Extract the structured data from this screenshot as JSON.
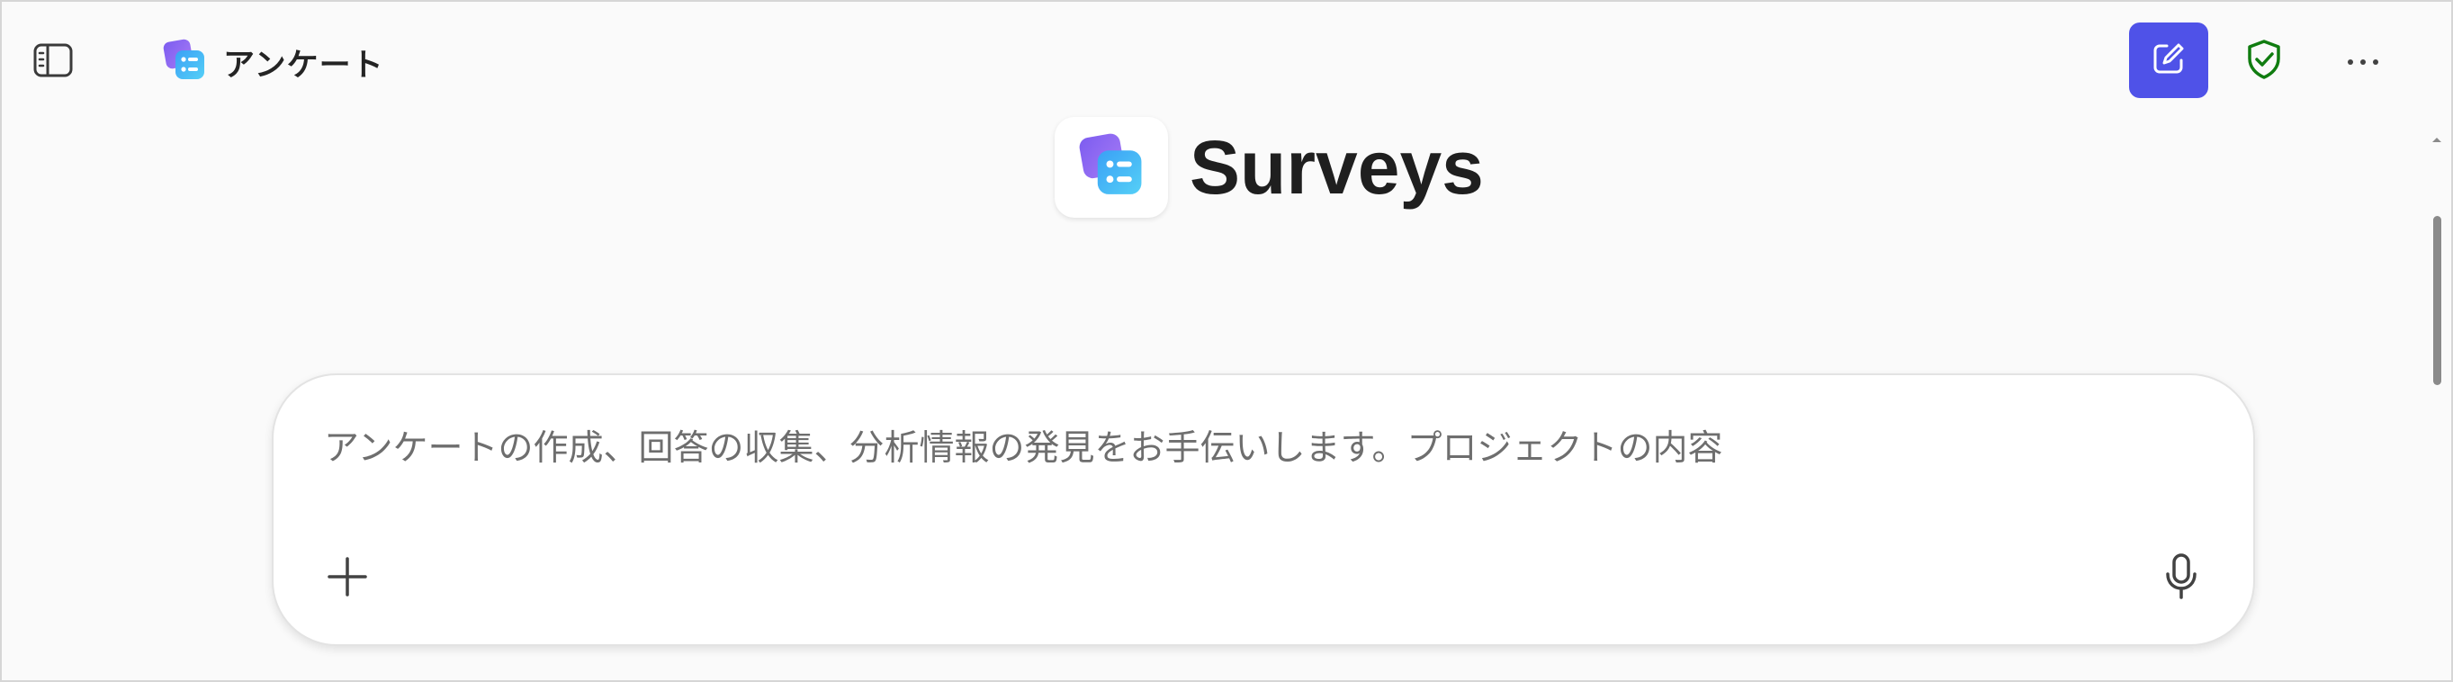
{
  "header": {
    "app_title": "アンケート",
    "icons": {
      "sidebar": "sidebar-toggle-icon",
      "app": "surveys-app-icon",
      "new_chat": "edit-square-icon",
      "shield": "shield-check-icon",
      "more": "more-horizontal-icon"
    },
    "accent_color": "#4f52e8",
    "shield_color": "#107c10"
  },
  "hero": {
    "title": "Surveys"
  },
  "composer": {
    "placeholder": "アンケートの作成、回答の収集、分析情報の発見をお手伝いします。プロジェクトの内容",
    "icons": {
      "attach": "plus-icon",
      "voice": "microphone-icon"
    }
  }
}
